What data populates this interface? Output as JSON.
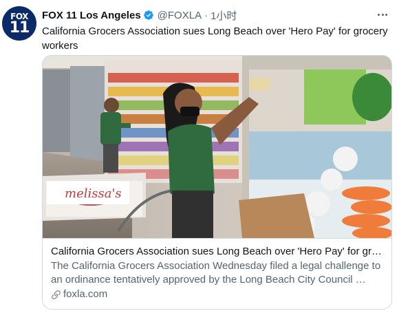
{
  "tweet": {
    "avatar": {
      "line1": "FOX",
      "line2": "11",
      "color": "#0b2a6a"
    },
    "author_name": "FOX 11 Los Angeles",
    "handle": "@FOXLA",
    "separator": "·",
    "time": "1小时",
    "verified_icon": "verified-badge-icon",
    "more_icon": "more-options-icon",
    "text": "California Grocers Association sues Long Beach over 'Hero Pay' for grocery workers"
  },
  "card": {
    "image_alt": "Grocery workers in green uniforms stocking produce shelves",
    "box_label": "melissa's",
    "title": "California Grocers Association sues Long Beach over 'Hero Pay' for groc…",
    "description": "The California Grocers Association Wednesday filed a legal challenge to an ordinance tentatively approved by the Long Beach City Council …",
    "domain": "foxla.com",
    "link_icon": "link-icon"
  },
  "colors": {
    "accent": "#1d9bf0",
    "text_primary": "#0f1419",
    "text_secondary": "#536471",
    "border": "#cfd9de",
    "uniform_green": "#2f6b3f"
  }
}
